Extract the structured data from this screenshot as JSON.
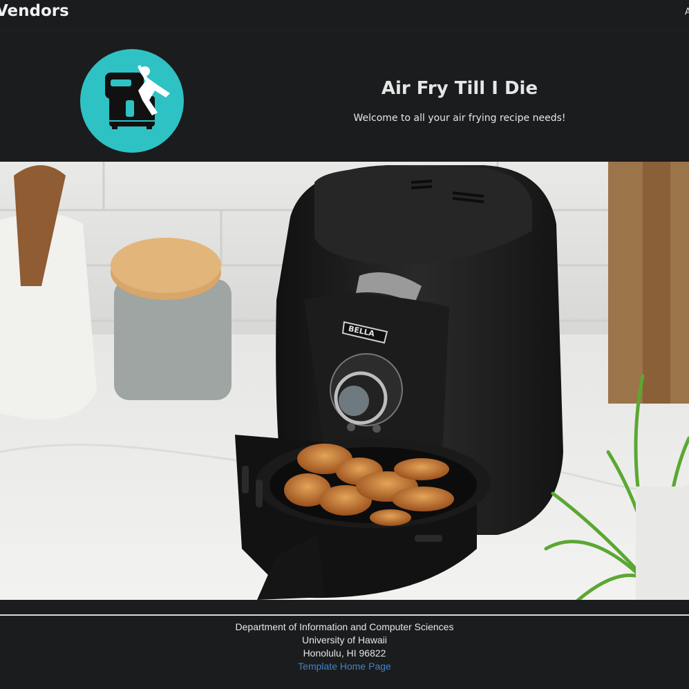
{
  "nav": {
    "brand": "Vendors",
    "right_link": "A"
  },
  "header": {
    "logo_icon": "air-fryer-logo-icon",
    "logo_color": "#2fc2c4",
    "title": "Air Fry Till I Die",
    "tagline": "Welcome to all your air frying recipe needs!"
  },
  "hero_image": {
    "appliance_brand": "BELLA"
  },
  "footer": {
    "line1": "Department of Information and Computer Sciences",
    "line2": "University of Hawaii",
    "line3": "Honolulu, HI 96822",
    "link": "Template Home Page",
    "link_color": "#4183c4"
  }
}
